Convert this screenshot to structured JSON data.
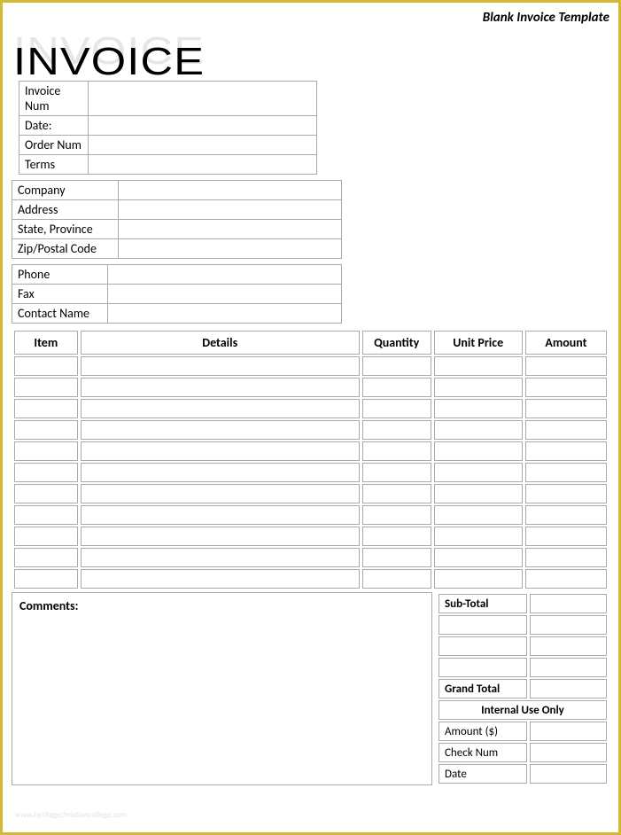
{
  "header_label": "Blank Invoice Template",
  "title": "INVOICE",
  "info_invoice": {
    "rows": [
      {
        "label": "Invoice Num",
        "value": ""
      },
      {
        "label": "Date:",
        "value": ""
      },
      {
        "label": "Order Num",
        "value": ""
      },
      {
        "label": "Terms",
        "value": ""
      }
    ]
  },
  "info_company": {
    "rows": [
      {
        "label": "Company",
        "value": ""
      },
      {
        "label": "Address",
        "value": ""
      },
      {
        "label": "State, Province",
        "value": ""
      },
      {
        "label": "Zip/Postal Code",
        "value": ""
      }
    ]
  },
  "info_contact": {
    "rows": [
      {
        "label": "Phone",
        "value": ""
      },
      {
        "label": "Fax",
        "value": ""
      },
      {
        "label": "Contact Name",
        "value": ""
      }
    ]
  },
  "line_items": {
    "headers": {
      "item": "Item",
      "details": "Details",
      "quantity": "Quantity",
      "unit_price": "Unit Price",
      "amount": "Amount"
    },
    "rows": [
      {
        "item": "",
        "details": "",
        "quantity": "",
        "unit_price": "",
        "amount": ""
      },
      {
        "item": "",
        "details": "",
        "quantity": "",
        "unit_price": "",
        "amount": ""
      },
      {
        "item": "",
        "details": "",
        "quantity": "",
        "unit_price": "",
        "amount": ""
      },
      {
        "item": "",
        "details": "",
        "quantity": "",
        "unit_price": "",
        "amount": ""
      },
      {
        "item": "",
        "details": "",
        "quantity": "",
        "unit_price": "",
        "amount": ""
      },
      {
        "item": "",
        "details": "",
        "quantity": "",
        "unit_price": "",
        "amount": ""
      },
      {
        "item": "",
        "details": "",
        "quantity": "",
        "unit_price": "",
        "amount": ""
      },
      {
        "item": "",
        "details": "",
        "quantity": "",
        "unit_price": "",
        "amount": ""
      },
      {
        "item": "",
        "details": "",
        "quantity": "",
        "unit_price": "",
        "amount": ""
      },
      {
        "item": "",
        "details": "",
        "quantity": "",
        "unit_price": "",
        "amount": ""
      },
      {
        "item": "",
        "details": "",
        "quantity": "",
        "unit_price": "",
        "amount": ""
      }
    ]
  },
  "comments_label": "Comments:",
  "comments_value": "",
  "totals": {
    "subtotal_label": "Sub-Total",
    "subtotal_value": "",
    "blank_rows": [
      {
        "label": "",
        "value": ""
      },
      {
        "label": "",
        "value": ""
      },
      {
        "label": "",
        "value": ""
      }
    ],
    "grandtotal_label": "Grand Total",
    "grandtotal_value": "",
    "internal_header": "Internal Use Only",
    "internal_rows": [
      {
        "label": "Amount ($)",
        "value": ""
      },
      {
        "label": "Check Num",
        "value": ""
      },
      {
        "label": "Date",
        "value": ""
      }
    ]
  },
  "watermark": "www.heritagechristiancollege.com"
}
